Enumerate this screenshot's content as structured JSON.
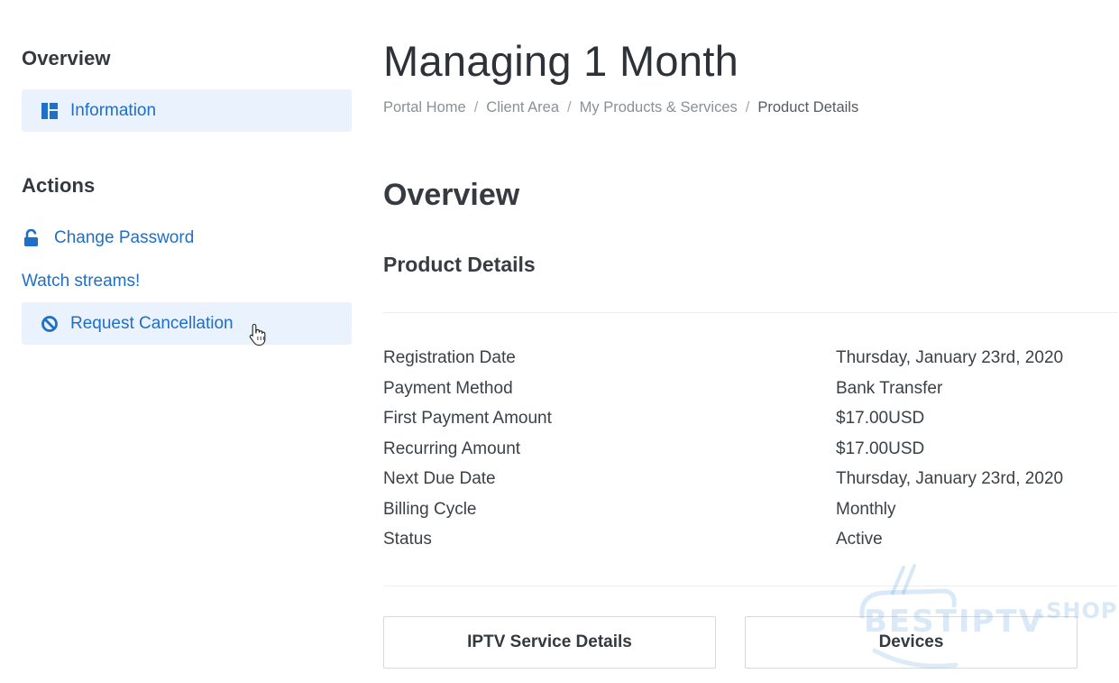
{
  "sidebar": {
    "overview_heading": "Overview",
    "information_label": "Information",
    "actions_heading": "Actions",
    "change_password_label": "Change Password",
    "watch_streams_label": "Watch streams!",
    "request_cancellation_label": "Request Cancellation"
  },
  "header": {
    "title": "Managing 1 Month",
    "breadcrumb": [
      "Portal Home",
      "Client Area",
      "My Products & Services",
      "Product Details"
    ],
    "separator": "/"
  },
  "main": {
    "overview_title": "Overview",
    "product_details_title": "Product Details",
    "details": [
      {
        "label": "Registration Date",
        "value": "Thursday, January 23rd, 2020"
      },
      {
        "label": "Payment Method",
        "value": "Bank Transfer"
      },
      {
        "label": "First Payment Amount",
        "value": "$17.00USD"
      },
      {
        "label": "Recurring Amount",
        "value": "$17.00USD"
      },
      {
        "label": "Next Due Date",
        "value": "Thursday, January 23rd, 2020"
      },
      {
        "label": "Billing Cycle",
        "value": "Monthly"
      },
      {
        "label": "Status",
        "value": "Active"
      }
    ],
    "buttons": {
      "iptv_label": "IPTV Service Details",
      "devices_label": "Devices"
    }
  },
  "watermark": {
    "text": "BESTIPTV",
    "suffix": ".SHOP"
  },
  "colors": {
    "link": "#1f6ec7",
    "active_bg": "#e9f2fd"
  }
}
